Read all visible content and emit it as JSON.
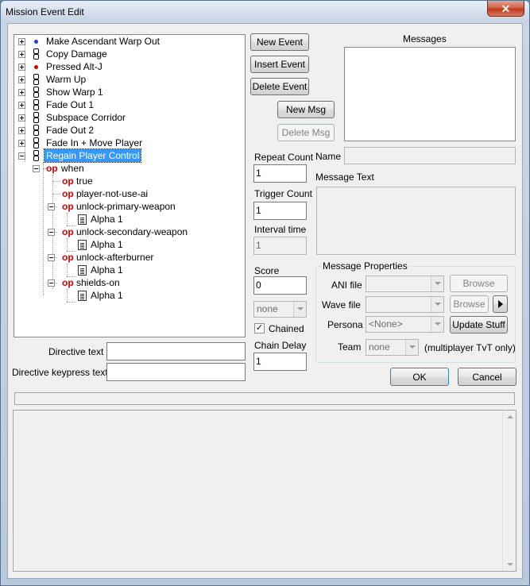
{
  "window": {
    "title": "Mission Event Edit",
    "close_glyph": "✕"
  },
  "tree": {
    "events": [
      {
        "label": "Make Ascendant Warp Out",
        "icon": "blue-dot-icon",
        "color": "#1f3fd6"
      },
      {
        "label": "Copy Damage",
        "icon": "chain-icon"
      },
      {
        "label": "Pressed Alt-J",
        "icon": "red-dot-icon",
        "color": "#d60000"
      },
      {
        "label": "Warm Up",
        "icon": "chain-icon"
      },
      {
        "label": "Show Warp 1",
        "icon": "chain-icon"
      },
      {
        "label": "Fade Out 1",
        "icon": "chain-icon"
      },
      {
        "label": "Subspace Corridor",
        "icon": "chain-icon"
      },
      {
        "label": "Fade Out 2",
        "icon": "chain-icon"
      },
      {
        "label": "Fade In + Move Player",
        "icon": "chain-icon"
      },
      {
        "label": "Regain Player Control",
        "icon": "chain-icon",
        "selected": true
      }
    ],
    "op_glyph": "op",
    "sub": {
      "when": "when",
      "true": "true",
      "player_not_use_ai": "player-not-use-ai",
      "unlock_primary": "unlock-primary-weapon",
      "alpha1_a": "Alpha 1",
      "unlock_secondary": "unlock-secondary-weapon",
      "alpha1_b": "Alpha 1",
      "unlock_afterburner": "unlock-afterburner",
      "alpha1_c": "Alpha 1",
      "shields_on": "shields-on",
      "alpha1_d": "Alpha 1"
    }
  },
  "buttons": {
    "new_event": "New Event",
    "insert_event": "Insert Event",
    "delete_event": "Delete Event",
    "new_msg": "New Msg",
    "delete_msg": "Delete Msg",
    "browse_ani": "Browse",
    "browse_wave": "Browse",
    "update_stuff": "Update Stuff",
    "ok": "OK",
    "cancel": "Cancel"
  },
  "fields": {
    "repeat_count_label": "Repeat Count",
    "repeat_count": "1",
    "trigger_count_label": "Trigger Count",
    "trigger_count": "1",
    "interval_time_label": "Interval time",
    "interval_time": "1",
    "score_label": "Score",
    "score": "0",
    "team_combo": "none",
    "chained_label": "Chained",
    "chained_mark": "✓",
    "chain_delay_label": "Chain Delay",
    "chain_delay": "1",
    "directive_text_label": "Directive text",
    "directive_text": "",
    "directive_keypress_label": "Directive keypress text",
    "directive_keypress": ""
  },
  "messages": {
    "header": "Messages",
    "name_label": "Name",
    "name_value": "",
    "message_text_label": "Message Text",
    "properties_title": "Message Properties",
    "ani_file_label": "ANI file",
    "wave_file_label": "Wave file",
    "persona_label": "Persona",
    "persona_value": "<None>",
    "team_label": "Team",
    "team_value": "none",
    "team_note": "(multiplayer TvT only)"
  },
  "colors": {
    "accent_selected": "#3399ff",
    "op_red": "#d40000"
  }
}
